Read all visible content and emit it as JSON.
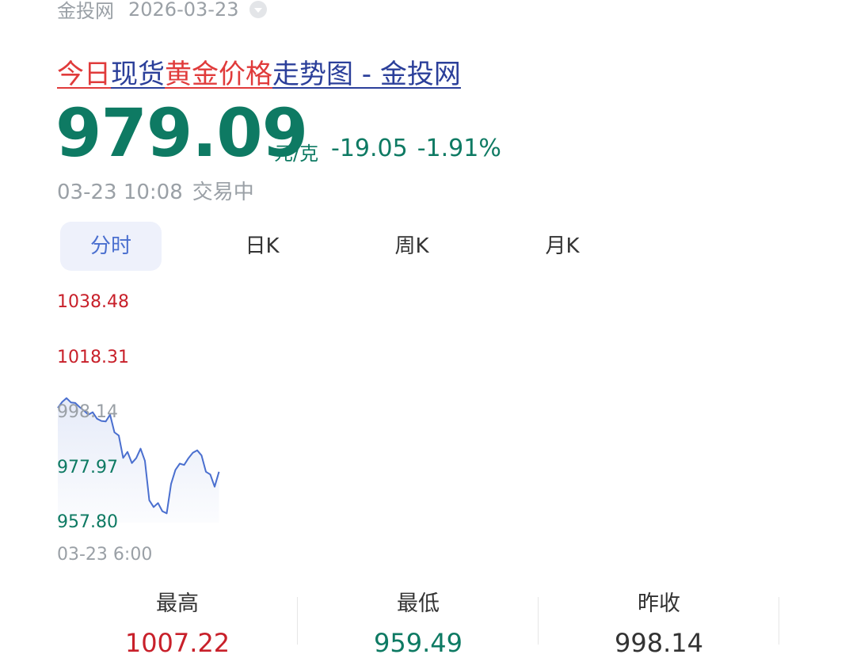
{
  "header": {
    "source": "金投网",
    "date": "2026-03-23"
  },
  "title": {
    "part1": "今日",
    "part2": "现货",
    "part3": "黄金价格",
    "part4": "走势图 - 金投网"
  },
  "quote": {
    "price": "979.09",
    "unit": "元/克",
    "change": "-19.05",
    "change_pct": "-1.91%",
    "time": "03-23 10:08",
    "status": "交易中"
  },
  "tabs": [
    {
      "label": "分时",
      "active": true
    },
    {
      "label": "日K",
      "active": false
    },
    {
      "label": "周K",
      "active": false
    },
    {
      "label": "月K",
      "active": false
    }
  ],
  "chart_data": {
    "type": "line",
    "y_ticks": [
      "1038.48",
      "1018.31",
      "998.14",
      "977.97",
      "957.80"
    ],
    "ylim": [
      957.8,
      1038.48
    ],
    "x_start_label": "03-23 6:00",
    "reference": 998.14,
    "line_color": "#4a6fcf",
    "series": [
      {
        "values": [
          1000.0,
          1002.2,
          1003.6,
          1002.0,
          1001.8,
          1000.3,
          999.0,
          997.5,
          998.4,
          996.0,
          995.2,
          995.0,
          997.5,
          991.0,
          989.8,
          981.6,
          983.8,
          979.7,
          981.5,
          985.0,
          980.5,
          966.0,
          963.5,
          965.0,
          962.0,
          961.2,
          972.0,
          977.2,
          979.5,
          979.0,
          981.5,
          983.5,
          984.4,
          982.5,
          976.5,
          975.5,
          971.0,
          976.5
        ]
      }
    ]
  },
  "stats": [
    {
      "label": "最高",
      "value": "1007.22",
      "color": "#c8202a"
    },
    {
      "label": "最低",
      "value": "959.49",
      "color": "#0e7a63"
    },
    {
      "label": "昨收",
      "value": "998.14",
      "color": "#333333"
    }
  ]
}
